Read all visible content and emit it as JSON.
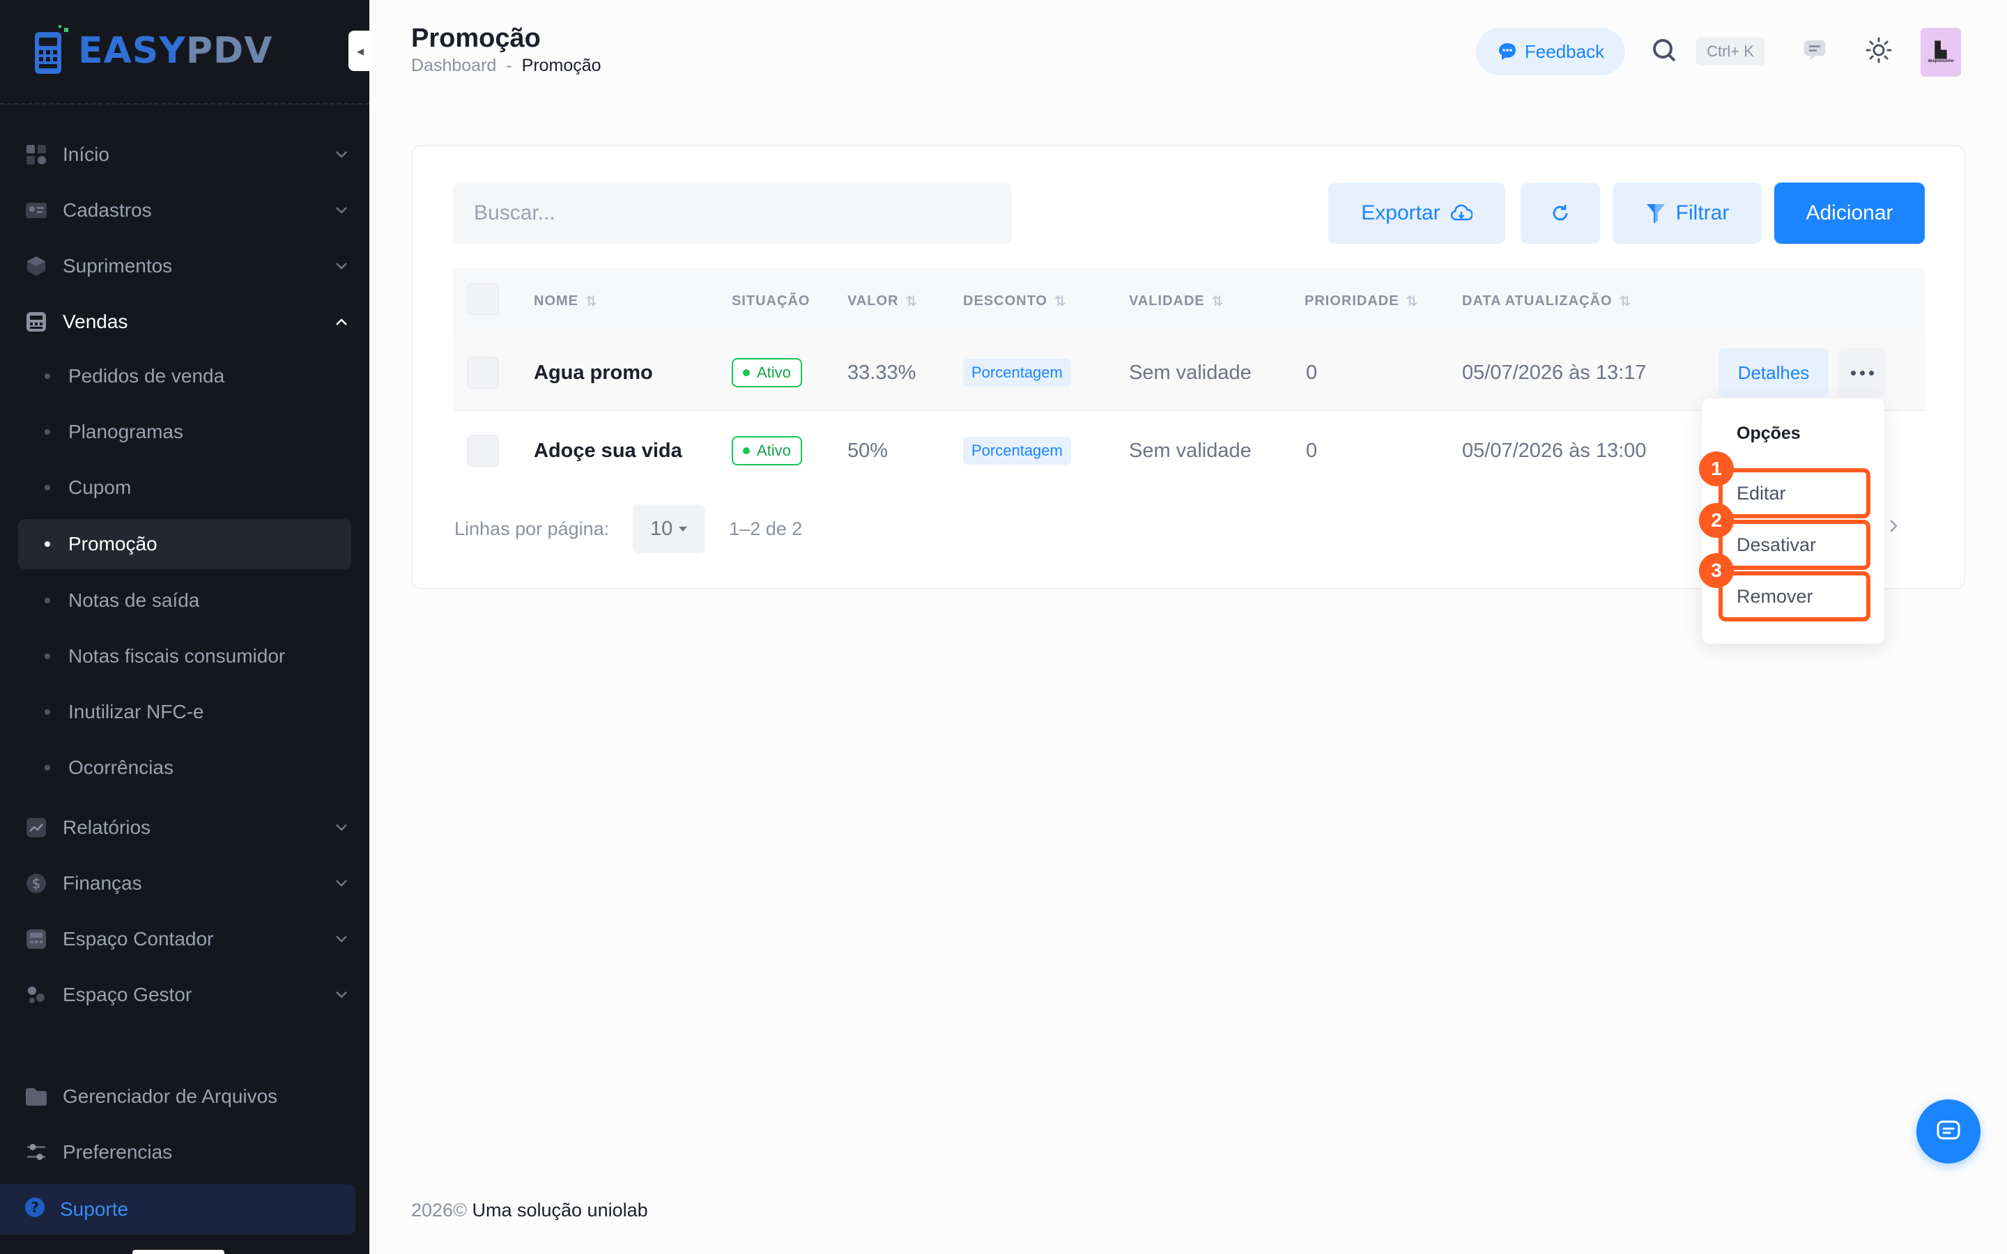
{
  "brand": {
    "logo_easy": "EASY",
    "logo_pdv": "PDV"
  },
  "sidebar": {
    "items": [
      {
        "label": "Início",
        "icon": "grid-icon"
      },
      {
        "label": "Cadastros",
        "icon": "id-card-icon"
      },
      {
        "label": "Suprimentos",
        "icon": "box-icon"
      },
      {
        "label": "Vendas",
        "icon": "register-icon"
      },
      {
        "label": "Relatórios",
        "icon": "chart-icon"
      },
      {
        "label": "Finanças",
        "icon": "dollar-icon"
      },
      {
        "label": "Espaço Contador",
        "icon": "calculator-icon"
      },
      {
        "label": "Espaço Gestor",
        "icon": "users-icon"
      },
      {
        "label": "Gerenciador de Arquivos",
        "icon": "folder-icon"
      },
      {
        "label": "Preferencias",
        "icon": "sliders-icon"
      }
    ],
    "vendas_sub": [
      {
        "label": "Pedidos de venda"
      },
      {
        "label": "Planogramas"
      },
      {
        "label": "Cupom"
      },
      {
        "label": "Promoção"
      },
      {
        "label": "Notas de saída"
      },
      {
        "label": "Notas fiscais consumidor"
      },
      {
        "label": "Inutilizar NFC-e"
      },
      {
        "label": "Ocorrências"
      }
    ],
    "support": "Suporte"
  },
  "header": {
    "title": "Promoção",
    "breadcrumb": [
      "Dashboard",
      "-",
      "Promoção"
    ],
    "feedback": "Feedback",
    "shortcut": "Ctrl+ K",
    "avatar_text": "desponsinho"
  },
  "toolbar": {
    "search_placeholder": "Buscar...",
    "export": "Exportar",
    "filter": "Filtrar",
    "add": "Adicionar"
  },
  "table": {
    "columns": [
      "NOME",
      "SITUAÇÃO",
      "VALOR",
      "DESCONTO",
      "VALIDADE",
      "PRIORIDADE",
      "DATA ATUALIZAÇÃO"
    ],
    "rows": [
      {
        "nome": "Agua promo",
        "situacao": "Ativo",
        "valor": "33.33%",
        "desconto": "Porcentagem",
        "validade": "Sem validade",
        "prioridade": "0",
        "data": "05/07/2026 às 13:17",
        "action": "Detalhes"
      },
      {
        "nome": "Adoçe sua vida",
        "situacao": "Ativo",
        "valor": "50%",
        "desconto": "Porcentagem",
        "validade": "Sem validade",
        "prioridade": "0",
        "data": "05/07/2026 às 13:00"
      }
    ]
  },
  "pager": {
    "label": "Linhas por página:",
    "size": "10",
    "count": "1–2 de 2"
  },
  "menu": {
    "title": "Opções",
    "items": [
      {
        "step": "1",
        "label": "Editar"
      },
      {
        "step": "2",
        "label": "Desativar"
      },
      {
        "step": "3",
        "label": "Remover"
      }
    ]
  },
  "footer": {
    "year": "2026©",
    "text": "Uma solução uniolab"
  },
  "colors": {
    "primary": "#1b84ff",
    "sidebar": "#15171e",
    "highlight": "#ff5a1f",
    "success": "#17c653"
  }
}
